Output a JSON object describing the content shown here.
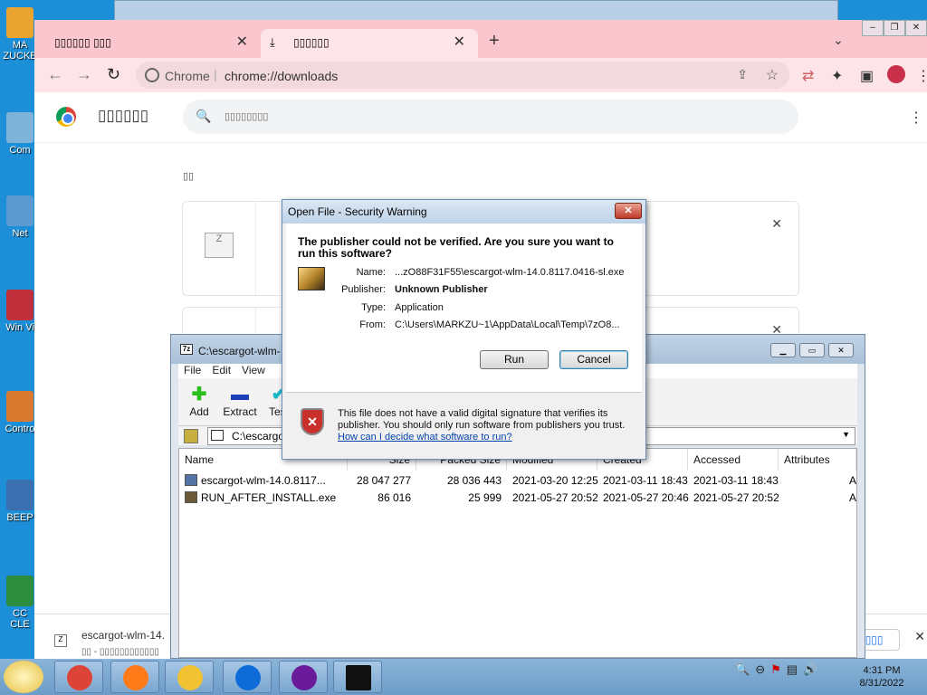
{
  "desktop": {
    "icons": [
      {
        "label": "MA ZUCKE",
        "color": "#e9a530"
      },
      {
        "label": "Com",
        "color": "#7fb3d8"
      },
      {
        "label": "Net",
        "color": "#5b9ad0"
      },
      {
        "label": "Win Vi",
        "color": "#c0303a"
      },
      {
        "label": "Contro",
        "color": "#d97a30"
      },
      {
        "label": "BEEP",
        "color": "#3a6fb0"
      },
      {
        "label": "CC CLE",
        "color": "#2c8d3e"
      }
    ]
  },
  "browser": {
    "tabs": [
      {
        "label": "▯▯▯▯▯▯ ▯▯▯"
      },
      {
        "label": "▯▯▯▯▯▯"
      }
    ],
    "new_tab": "+",
    "address": {
      "scheme": "Chrome",
      "url": "chrome://downloads"
    },
    "page": {
      "title": "▯▯▯▯▯▯",
      "search_placeholder": "▯▯▯▯▯▯▯▯",
      "date_header": "▯▯",
      "card_icon": "Z"
    },
    "shelf": {
      "file_name": "escargot-wlm-14.",
      "file_status": "▯▯ - ▯▯▯▯▯▯▯▯▯▯▯▯",
      "show_all": "▯▯▯▯▯"
    }
  },
  "sevenzip": {
    "title": "C:\\escargot-wlm-",
    "menu": [
      "File",
      "Edit",
      "View"
    ],
    "tools": [
      {
        "label": "Add",
        "glyph": "✚",
        "color": "#2bbf1e"
      },
      {
        "label": "Extract",
        "glyph": "▬",
        "color": "#1d3fb8"
      },
      {
        "label": "Test",
        "glyph": "✔",
        "color": "#18b7c9"
      }
    ],
    "address": "C:\\escargo",
    "columns": [
      "Name",
      "Size",
      "Packed Size",
      "Modified",
      "Created",
      "Accessed",
      "Attributes"
    ],
    "rows": [
      {
        "name": "escargot-wlm-14.0.8117...",
        "size": "28 047 277",
        "packed": "28 036 443",
        "modified": "2021-03-20 12:25",
        "created": "2021-03-11 18:43",
        "accessed": "2021-03-11 18:43",
        "attr": "A"
      },
      {
        "name": "RUN_AFTER_INSTALL.exe",
        "size": "86 016",
        "packed": "25 999",
        "modified": "2021-05-27 20:52",
        "created": "2021-05-27 20:46",
        "accessed": "2021-05-27 20:52",
        "attr": "A"
      }
    ]
  },
  "dialog": {
    "title": "Open File - Security Warning",
    "question": "The publisher could not be verified.  Are you sure you want to run this software?",
    "fields": [
      {
        "label": "Name:",
        "value": "...zO88F31F55\\escargot-wlm-14.0.8117.0416-sl.exe",
        "bold": false
      },
      {
        "label": "Publisher:",
        "value": "Unknown Publisher",
        "bold": true
      },
      {
        "label": "Type:",
        "value": "Application",
        "bold": false
      },
      {
        "label": "From:",
        "value": "C:\\Users\\MARKZU~1\\AppData\\Local\\Temp\\7zO8...",
        "bold": false
      }
    ],
    "run_label": "Run",
    "cancel_label": "Cancel",
    "warning": "This file does not have a valid digital signature that verifies its publisher.  You should only run software from publishers you trust.",
    "help_link": "How can I decide what software to run?"
  },
  "taskbar": {
    "apps": [
      {
        "name": "chrome",
        "color": "#db4437"
      },
      {
        "name": "firefox",
        "color": "#ff7a18"
      },
      {
        "name": "folder",
        "color": "#f1c232"
      },
      {
        "name": "teamviewer",
        "color": "#0e6cd8"
      },
      {
        "name": "yahoo",
        "color": "#6a1b9a"
      },
      {
        "name": "7zip",
        "color": "#111111"
      }
    ],
    "time": "4:31 PM",
    "date": "8/31/2022"
  }
}
